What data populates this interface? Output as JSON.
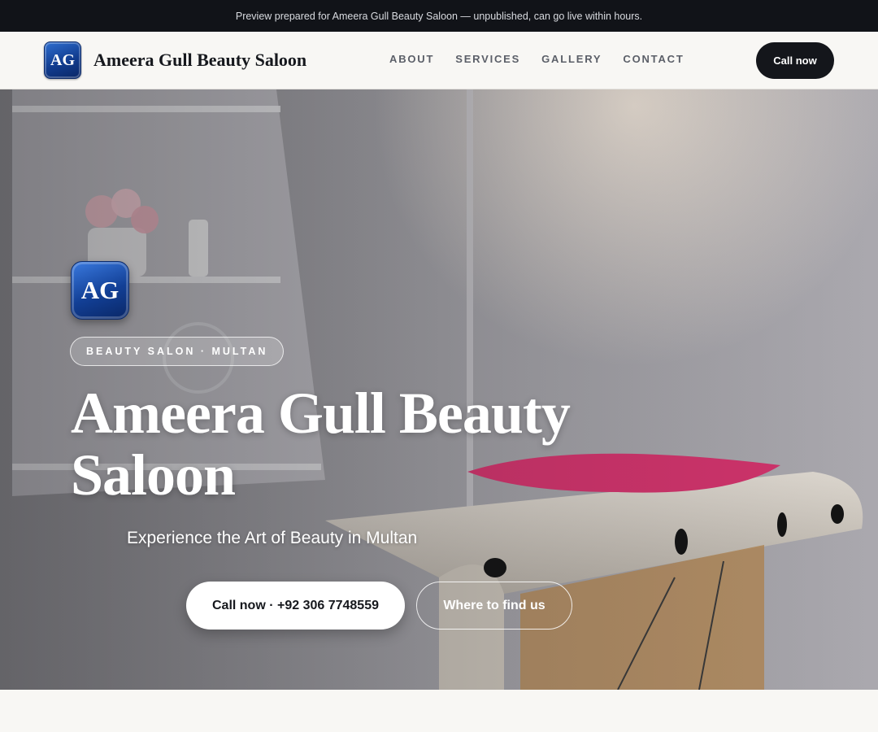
{
  "preview_bar": {
    "text": "Preview prepared for Ameera Gull Beauty Saloon — unpublished, can go live within hours."
  },
  "header": {
    "logo_text": "AG",
    "brand_name": "Ameera Gull Beauty Saloon",
    "nav": [
      "ABOUT",
      "SERVICES",
      "GALLERY",
      "CONTACT"
    ],
    "call_button": "Call now"
  },
  "hero": {
    "logo_text": "AG",
    "badge": "BEAUTY SALON · MULTAN",
    "title": "Ameera Gull Beauty Saloon",
    "subtitle": "Experience the Art of Beauty in Multan",
    "primary_button": "Call now · +92 306 7748559",
    "secondary_button": "Where to find us",
    "background_icon": "salon-treatment-room-photo"
  },
  "colors": {
    "dark": "#111318",
    "logo_blue": "#123f95",
    "pillow_pink": "#d9346f",
    "page_bg": "#f8f7f4"
  }
}
